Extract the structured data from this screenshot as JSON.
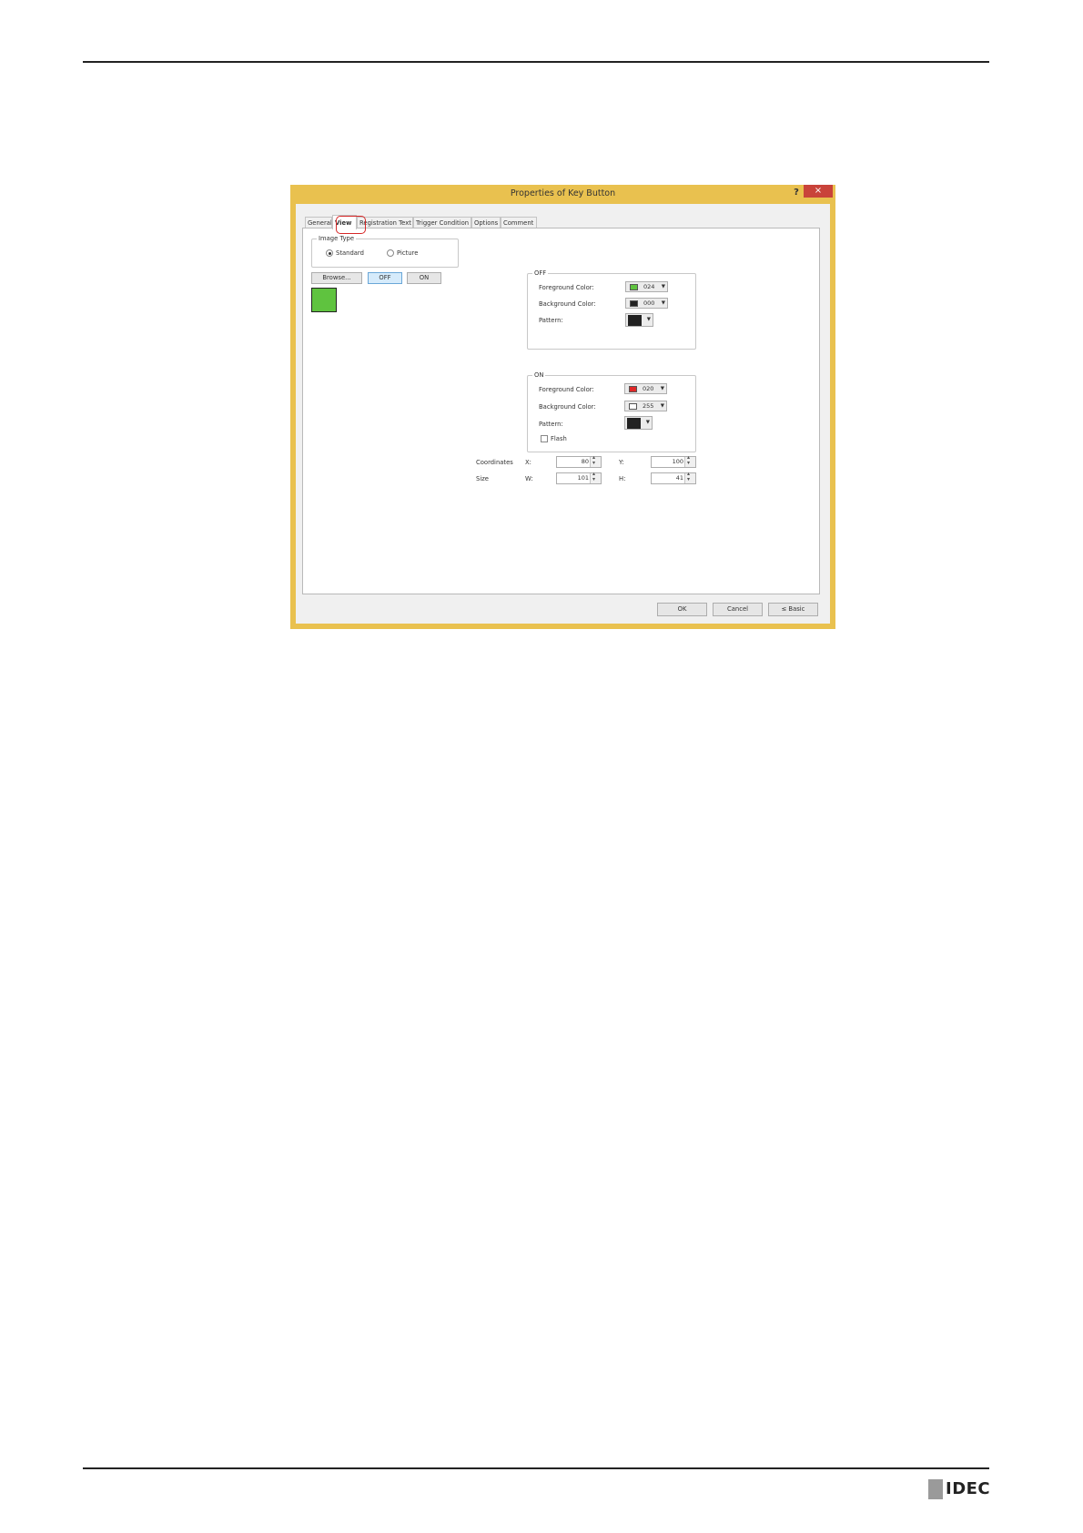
{
  "dialog": {
    "title": "Properties of Key Button",
    "help_label": "?",
    "close_label": "×"
  },
  "tabs": [
    {
      "label": "General"
    },
    {
      "label": "View"
    },
    {
      "label": "Registration Text"
    },
    {
      "label": "Trigger Condition"
    },
    {
      "label": "Options"
    },
    {
      "label": "Comment"
    }
  ],
  "image_type": {
    "legend": "Image Type",
    "standard_label": "Standard",
    "picture_label": "Picture",
    "selected": "Standard"
  },
  "image_buttons": {
    "browse_label": "Browse...",
    "off_label": "OFF",
    "on_label": "ON"
  },
  "preview": {
    "color": "#5fc33f"
  },
  "off_group": {
    "legend": "OFF",
    "foreground_label": "Foreground Color:",
    "foreground_value": "024",
    "foreground_color": "#5fc33f",
    "background_label": "Background Color:",
    "background_value": "000",
    "background_color": "#222222",
    "pattern_label": "Pattern:",
    "pattern_color": "#222222"
  },
  "on_group": {
    "legend": "ON",
    "foreground_label": "Foreground Color:",
    "foreground_value": "020",
    "foreground_color": "#e02828",
    "background_label": "Background Color:",
    "background_value": "255",
    "background_color": "#ffffff",
    "pattern_label": "Pattern:",
    "pattern_color": "#222222",
    "flash_label": "Flash",
    "flash_checked": false
  },
  "coordinates": {
    "label": "Coordinates",
    "x_label": "X:",
    "x_value": "80",
    "y_label": "Y:",
    "y_value": "100"
  },
  "size": {
    "label": "Size",
    "w_label": "W:",
    "w_value": "101",
    "h_label": "H:",
    "h_value": "41"
  },
  "footer": {
    "ok_label": "OK",
    "cancel_label": "Cancel",
    "basic_label": "≤ Basic"
  },
  "brand": {
    "logo_text": "IDEC"
  }
}
